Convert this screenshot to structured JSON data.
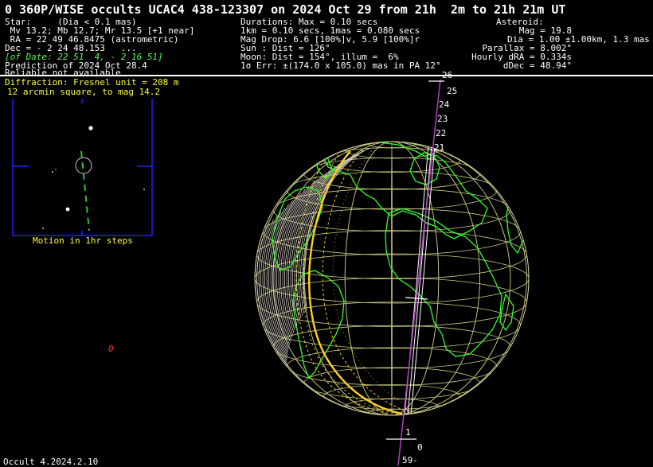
{
  "title": "0 360P/WISE occults UCAC4 438-123307 on 2024 Oct 29 from 21h  2m to 21h 21m UT",
  "star": {
    "heading": "Star:     (Dia < 0.1 mas)",
    "mags": " Mv 13.2; Mb 12.7; Mr 13.5 [+1 near]",
    "ra": " RA = 22 49 46.8475 (astrometric)",
    "dec": "Dec = - 2 24 48.153   ...",
    "of_date": "[of Date: 22 51  4, - 2 16 51]",
    "prediction": "Prediction of 2024 Oct 28.4",
    "reliable": "Reliable not available"
  },
  "middle": {
    "durations": "Durations: Max = 0.10 secs",
    "km": "1km = 0.10 secs, 1mas = 0.080 secs",
    "mag_drop": "Mag Drop: 6.6 [100%]v, 5.9 [100%]r",
    "sun": "Sun : Dist = 126°",
    "moon": "Moon: Dist = 154°, illum =  6%",
    "error": "1σ Err: ±(174.0 x 105.0) mas in PA 12°"
  },
  "asteroid": {
    "heading": "Asteroid:",
    "mag": "Mag = 19.8",
    "dia": "Dia = 1.00 ±1.00km, 1.3 mas",
    "parallax": "Parallax = 8.002\"",
    "hourly_dra": "Hourly dRA = 0.334s",
    "ddec": "dDec = 48.94\""
  },
  "starchart": {
    "diffraction": "Diffraction: Fresnel unit = 208 m",
    "field": "12 arcmin square, to mag 14.2",
    "motion": "Motion in 1hr steps"
  },
  "globe": {
    "tick_labels_top": [
      "26",
      "25",
      "24",
      "23",
      "22",
      "21"
    ],
    "tick_labels_bottom": [
      "1",
      "0",
      "59-"
    ],
    "marker": "0"
  },
  "footer": "Occult 4.2024.2.10",
  "colors": {
    "background": "#000000",
    "grid": "#c8c880",
    "land": "#30ff30",
    "path": "#ffd020",
    "text_yellow": "#ffff40",
    "chart_frame": "#2020ff"
  }
}
